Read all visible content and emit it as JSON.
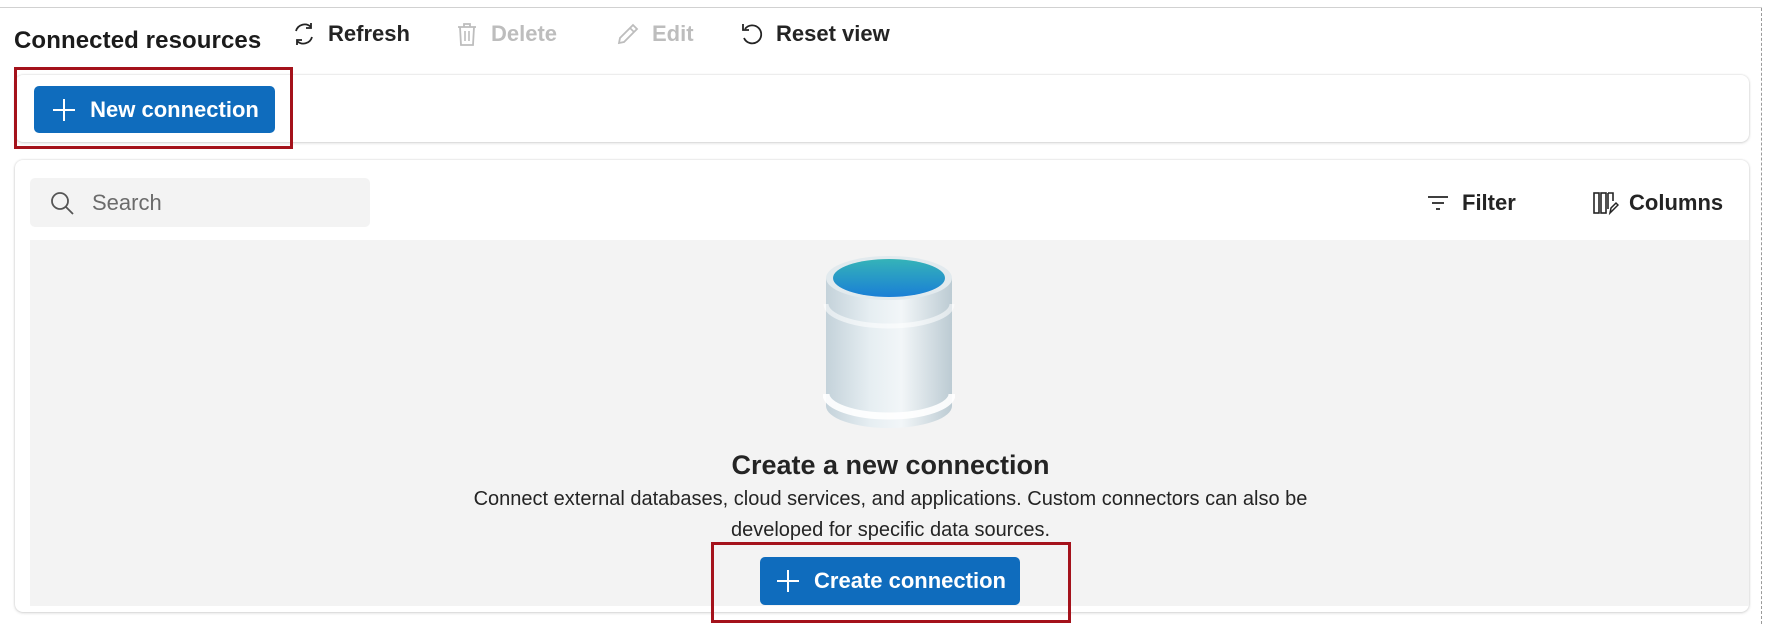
{
  "section": {
    "title": "Connected resources"
  },
  "toolbar": {
    "new_connection": {
      "label": "New connection",
      "icon": "plus-icon"
    },
    "refresh": {
      "label": "Refresh",
      "icon": "refresh-icon"
    },
    "delete": {
      "label": "Delete",
      "icon": "trash-icon",
      "disabled": true
    },
    "edit": {
      "label": "Edit",
      "icon": "pencil-icon",
      "disabled": true
    },
    "reset_view": {
      "label": "Reset view",
      "icon": "reset-icon"
    }
  },
  "grid": {
    "search": {
      "placeholder": "Search",
      "value": ""
    },
    "filter": {
      "label": "Filter",
      "icon": "filter-icon"
    },
    "columns": {
      "label": "Columns",
      "icon": "columns-icon"
    }
  },
  "empty_state": {
    "illustration": "database-icon",
    "title": "Create a new connection",
    "description": "Connect external databases, cloud services, and applications. Custom connectors can also be developed for specific data sources.",
    "button": {
      "label": "Create connection",
      "icon": "plus-icon"
    }
  },
  "colors": {
    "primary": "#0f6cbd",
    "highlight": "#a4121b",
    "empty_bg": "#f3f3f3",
    "disabled_text": "#bdbdbd"
  }
}
